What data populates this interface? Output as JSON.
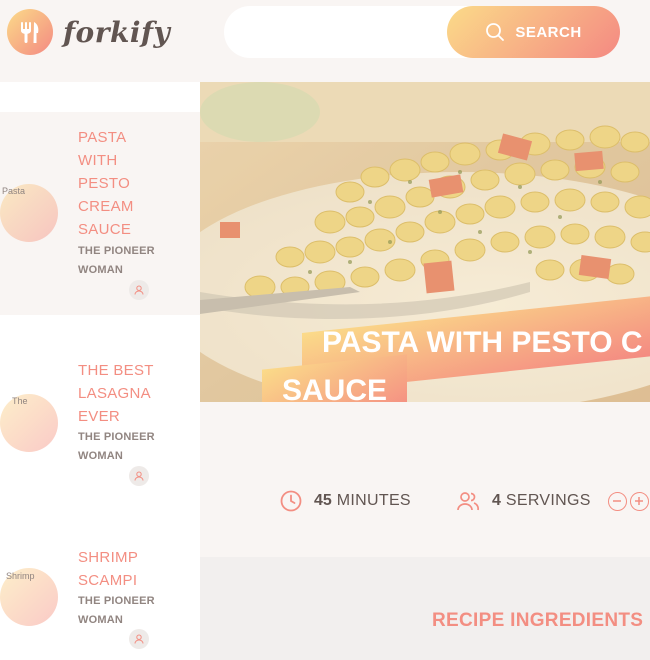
{
  "app": {
    "logo_text": "forkify"
  },
  "search": {
    "value": "",
    "placeholder": "",
    "button_label": "SEARCH"
  },
  "results": [
    {
      "title_lines": [
        "PASTA",
        "WITH",
        "PESTO",
        "CREAM",
        "SAUCE"
      ],
      "publisher_lines": [
        "THE PIONEER",
        "WOMAN"
      ],
      "image_alt": "Pasta",
      "active": true
    },
    {
      "title_lines": [
        "THE BEST",
        "LASAGNA",
        "EVER"
      ],
      "publisher_lines": [
        "THE PIONEER",
        "WOMAN"
      ],
      "image_alt": "The",
      "active": false
    },
    {
      "title_lines": [
        "SHRIMP",
        "SCAMPI"
      ],
      "publisher_lines": [
        "THE PIONEER",
        "WOMAN"
      ],
      "image_alt": "Shrimp",
      "active": false
    }
  ],
  "recipe": {
    "title_line1": "PASTA WITH PESTO C",
    "title_line2": "SAUCE",
    "cooking_time": "45",
    "cooking_unit": "MINUTES",
    "servings": "4",
    "servings_unit": "SERVINGS",
    "ingredients_heading": "RECIPE INGREDIENTS"
  },
  "colors": {
    "accent": "#f38e82",
    "gradient_start": "#fbdb89",
    "gradient_end": "#f48982",
    "text": "#615551"
  },
  "icons": {
    "logo": "fork-knife-icon",
    "search": "search-icon",
    "user": "user-icon",
    "clock": "clock-icon",
    "users": "users-icon",
    "minus": "minus-circle-icon",
    "plus": "plus-circle-icon"
  }
}
